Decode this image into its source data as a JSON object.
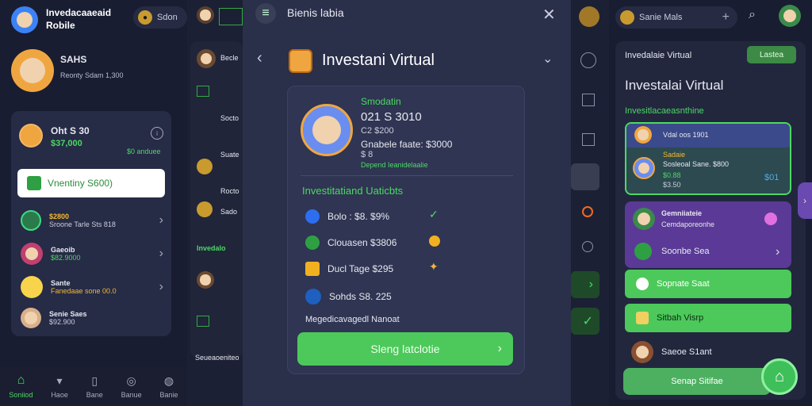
{
  "left": {
    "app_title_line1": "Invedacaaeaid",
    "app_title_line2": "Robile",
    "search_label": "Sdon",
    "user_code": "SAHS",
    "user_balance_line": "Reonty Sdam 1,300",
    "wallet": {
      "title": "Oht S 30",
      "amount": "$37,000",
      "status": "$0 anduee"
    },
    "highlight_button": "Vnentiny S600)",
    "list": [
      {
        "title": "$2800",
        "subtitle": "Sroone Tarle Sts 818"
      },
      {
        "title": "Gaeoib",
        "subtitle": "$82.9000"
      },
      {
        "title": "Sante",
        "subtitle": "Fanedaae sone 00.0"
      },
      {
        "title": "Senie Saes",
        "subtitle": "$92.900"
      }
    ],
    "nav": [
      "Soniiod",
      "Haoe",
      "Bane",
      "Banue",
      "Banie"
    ]
  },
  "mid": {
    "header": "Becle",
    "items": [
      "Socto",
      "Suate",
      "Rocto",
      "Sado"
    ],
    "section": "Invedalo",
    "footer": "Seueaoeniteo"
  },
  "panel": {
    "top_title": "Bienis labia",
    "heading": "Investani Virtual",
    "profile": {
      "label": "Smodatin",
      "value": "021 S 3010",
      "line1": "C2 $200",
      "line2": "Gnabele faate: $3000",
      "line3": "$ 8",
      "line4": "Depend Ieanidelaalie"
    },
    "section_title": "Investitatiand Uaticbts",
    "rows": [
      {
        "text": "Bolo : $8. $9%"
      },
      {
        "text": "Clouasen $3806"
      },
      {
        "text": "Ducl Tage $295"
      },
      {
        "text": "Sohds S8. 225"
      }
    ],
    "footer_note": "Megedicavagedl Nanoat",
    "cta": "Sleng latclotie"
  },
  "right": {
    "search_label": "Sanie Mals",
    "title_small": "Invedalaie Virtual",
    "badge": "Lastea",
    "heading": "Investalai Virtual",
    "sub_heading": "Invesitlacaeasnthine",
    "card1": {
      "line1": "Vdal oos 1901",
      "line2": "Sadaie",
      "line3": "Sosleoal Sane. $800",
      "line4": "$0.88",
      "line5": "$3.50",
      "badge": "$01"
    },
    "card2": {
      "line1": "Gemniiateie",
      "line2": "Cemdaporeonhe",
      "line3": "Soonbe Sea"
    },
    "btn1": "Sopnate Saat",
    "btn2": "Sitbah Visrp",
    "item": "Saeoe S1ant",
    "cta": "Senap Sitifae"
  }
}
